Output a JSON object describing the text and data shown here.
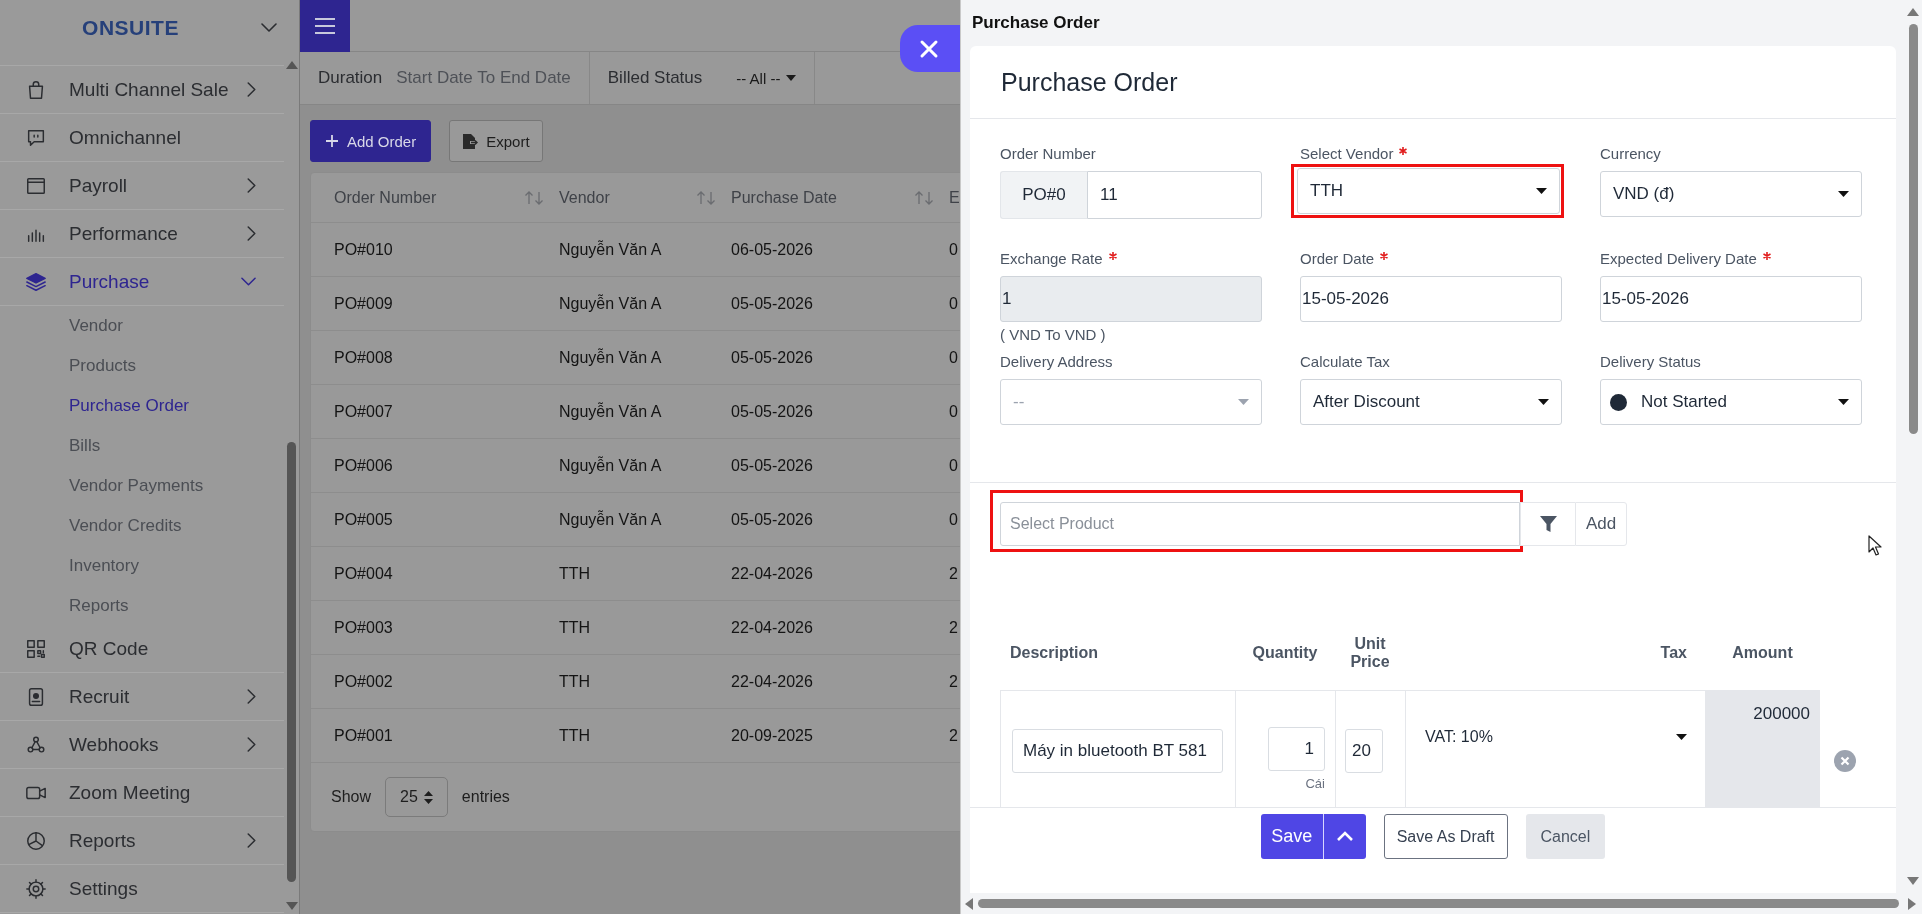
{
  "sidebar": {
    "brand": "ONSUITE",
    "items": [
      {
        "label": "Multi Channel Sale",
        "submenu": true,
        "expanded": false
      },
      {
        "label": "Omnichannel",
        "submenu": false,
        "expanded": false
      },
      {
        "label": "Payroll",
        "submenu": true,
        "expanded": false
      },
      {
        "label": "Performance",
        "submenu": true,
        "expanded": false
      },
      {
        "label": "Purchase",
        "submenu": true,
        "expanded": true,
        "children": [
          {
            "label": "Vendor",
            "selected": false
          },
          {
            "label": "Products",
            "selected": false
          },
          {
            "label": "Purchase Order",
            "selected": true
          },
          {
            "label": "Bills",
            "selected": false
          },
          {
            "label": "Vendor Payments",
            "selected": false
          },
          {
            "label": "Vendor Credits",
            "selected": false
          },
          {
            "label": "Inventory",
            "selected": false
          },
          {
            "label": "Reports",
            "selected": false
          }
        ]
      },
      {
        "label": "QR Code",
        "submenu": false,
        "expanded": false
      },
      {
        "label": "Recruit",
        "submenu": true,
        "expanded": false
      },
      {
        "label": "Webhooks",
        "submenu": true,
        "expanded": false
      },
      {
        "label": "Zoom Meeting",
        "submenu": false,
        "expanded": false
      },
      {
        "label": "Reports",
        "submenu": true,
        "expanded": false
      },
      {
        "label": "Settings",
        "submenu": false,
        "expanded": false
      }
    ]
  },
  "orders": {
    "filters": [
      {
        "kind": "date-range",
        "label": "Duration",
        "placeholder": "Start Date To End Date"
      },
      {
        "kind": "dropdown",
        "label": "Billed Status",
        "value": "-- All --"
      }
    ],
    "buttons": [
      {
        "kind": "primary",
        "label": "Add Order"
      },
      {
        "kind": "outline",
        "label": "Export"
      }
    ],
    "table": {
      "columns": [
        {
          "label": "Order Number",
          "sortable": true
        },
        {
          "label": "Vendor",
          "sortable": true
        },
        {
          "label": "Purchase Date",
          "sortable": true
        },
        {
          "label": "E"
        }
      ],
      "rows": [
        [
          "PO#010",
          "Nguyễn Văn A",
          "06-05-2026",
          "0"
        ],
        [
          "PO#009",
          "Nguyễn Văn A",
          "05-05-2026",
          "0"
        ],
        [
          "PO#008",
          "Nguyễn Văn A",
          "05-05-2026",
          "0"
        ],
        [
          "PO#007",
          "Nguyễn Văn A",
          "05-05-2026",
          "0"
        ],
        [
          "PO#006",
          "Nguyễn Văn A",
          "05-05-2026",
          "0"
        ],
        [
          "PO#005",
          "Nguyễn Văn A",
          "05-05-2026",
          "0"
        ],
        [
          "PO#004",
          "TTH",
          "22-04-2026",
          "2"
        ],
        [
          "PO#003",
          "TTH",
          "22-04-2026",
          "2"
        ],
        [
          "PO#002",
          "TTH",
          "22-04-2026",
          "2"
        ],
        [
          "PO#001",
          "TTH",
          "20-09-2025",
          "2"
        ]
      ]
    },
    "pagination": {
      "show": "Show",
      "page_size": "25",
      "entries": "entries"
    }
  },
  "modal": {
    "title": "Purchase Order",
    "heading": "Purchase Order",
    "fields": [
      {
        "kind": "prefixed",
        "label": "Order Number",
        "required": false,
        "highlighted": false,
        "prefix": "PO#0",
        "value": "11"
      },
      {
        "kind": "select",
        "label": "Select Vendor",
        "required": true,
        "highlighted": true,
        "value": "TTH"
      },
      {
        "kind": "select",
        "label": "Currency",
        "required": false,
        "highlighted": false,
        "value": "VND (đ)"
      },
      {
        "kind": "readonly",
        "label": "Exchange Rate",
        "required": true,
        "highlighted": false,
        "value": "1",
        "note": "( VND To VND )"
      },
      {
        "kind": "text",
        "label": "Order Date",
        "required": true,
        "highlighted": false,
        "value": "15-05-2026"
      },
      {
        "kind": "text",
        "label": "Expected Delivery Date",
        "required": true,
        "highlighted": false,
        "value": "15-05-2026"
      },
      {
        "kind": "select",
        "label": "Delivery Address",
        "required": false,
        "highlighted": false,
        "placeholder": "--"
      },
      {
        "kind": "select",
        "label": "Calculate Tax",
        "required": false,
        "highlighted": false,
        "value": "After Discount"
      },
      {
        "kind": "status",
        "label": "Delivery Status",
        "required": false,
        "highlighted": false,
        "value": "Not Started",
        "color": "#1f2937"
      }
    ],
    "product_picker": {
      "placeholder": "Select Product",
      "highlighted": true,
      "add": "Add"
    },
    "items": {
      "columns": [
        "Description",
        "Quantity",
        "Unit Price",
        "Tax",
        "Amount"
      ],
      "rows": [
        {
          "description": "Máy in bluetooth BT 581",
          "quantity": "1",
          "unit": "Cái",
          "unit_price": "20",
          "tax": "VAT: 10%",
          "amount": "200000"
        }
      ]
    },
    "buttons": [
      {
        "kind": "primary",
        "label": "Save"
      },
      {
        "kind": "outline",
        "label": "Save As Draft"
      },
      {
        "kind": "muted",
        "label": "Cancel"
      }
    ]
  }
}
